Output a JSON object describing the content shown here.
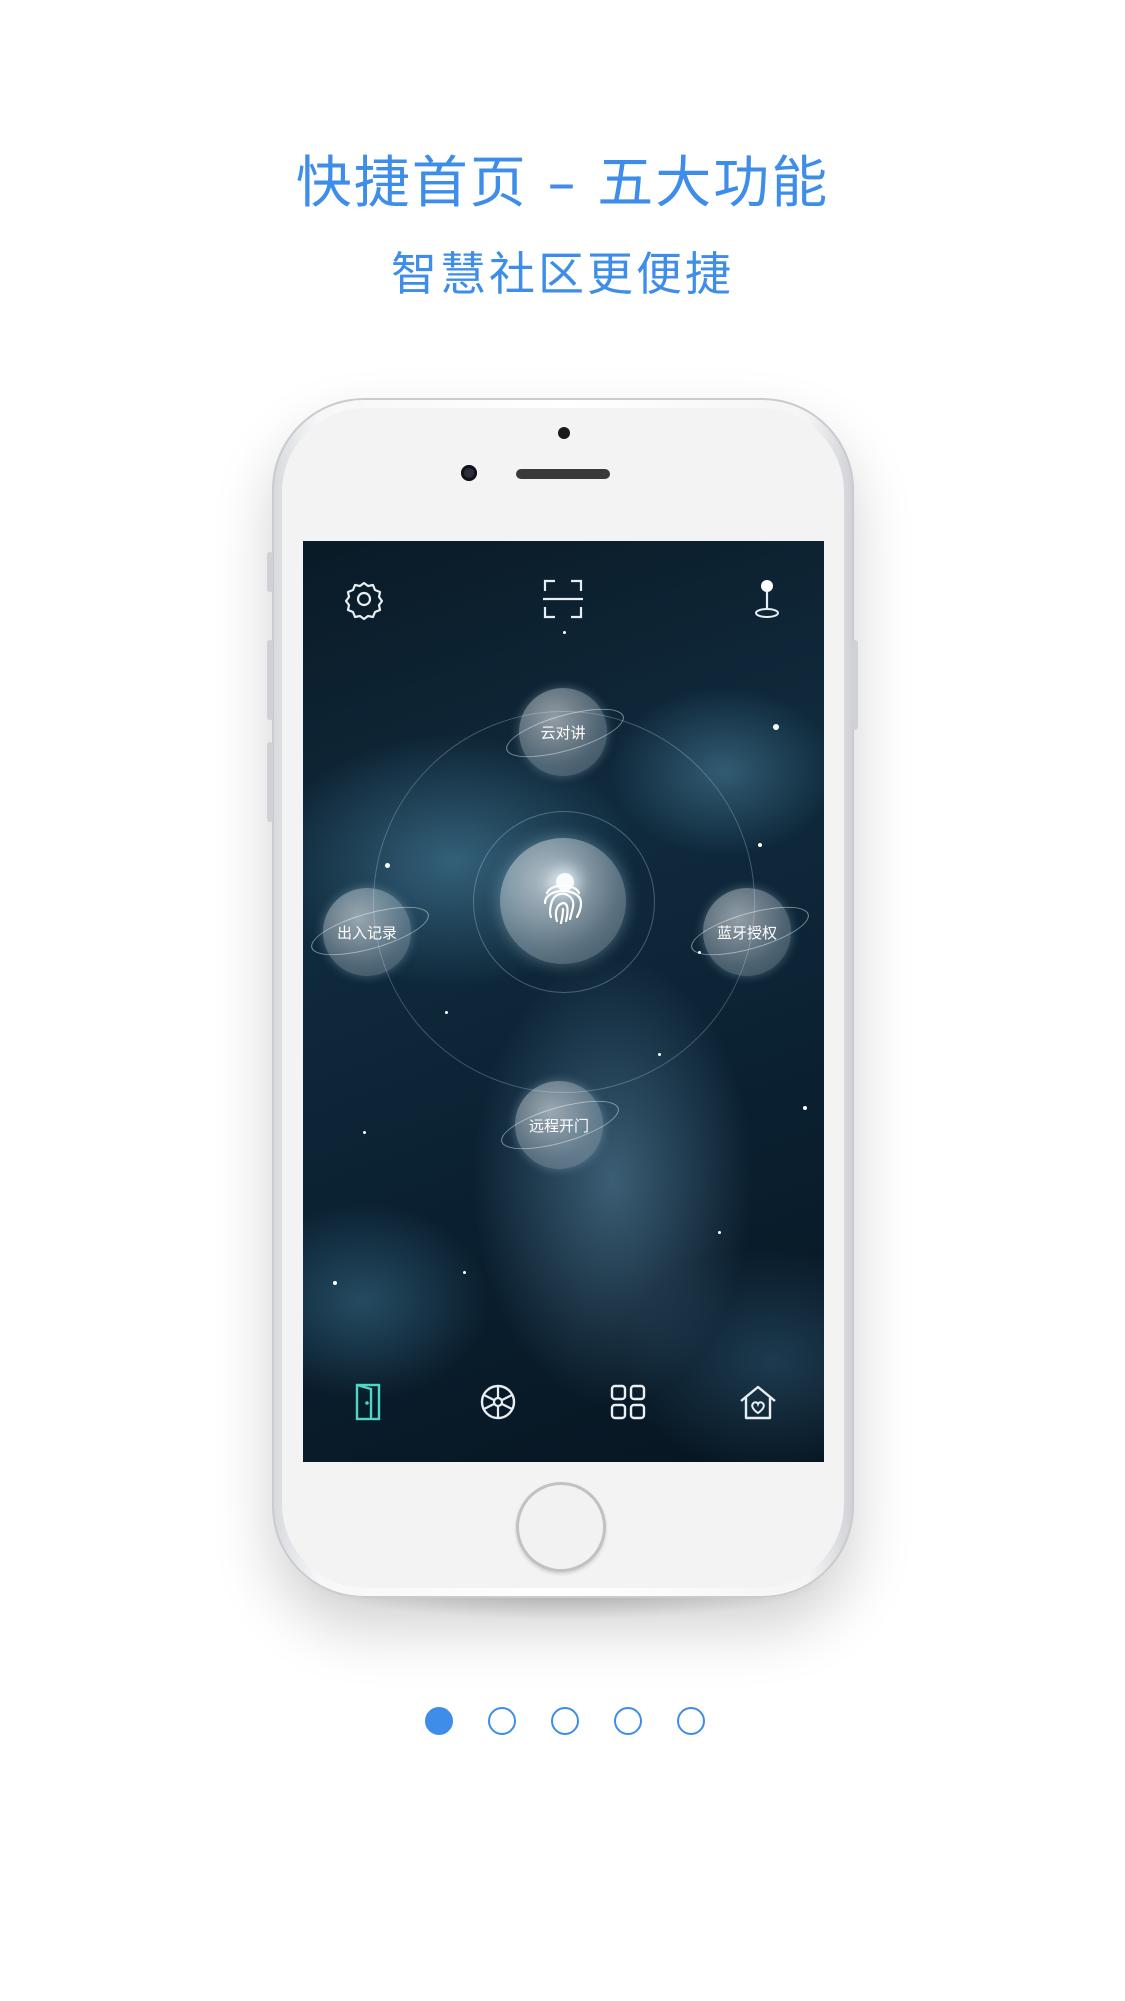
{
  "header": {
    "title": "快捷首页 – 五大功能",
    "subtitle": "智慧社区更便捷"
  },
  "screen": {
    "top_bar": {
      "left_icon": "gear-icon",
      "center_icon": "scan-icon",
      "right_icon": "location-pin-icon"
    },
    "features": {
      "top": "云对讲",
      "left": "出入记录",
      "right": "蓝牙授权",
      "bottom": "远程开门",
      "center_icon": "fingerprint-icon"
    },
    "tab_bar": {
      "items": [
        {
          "icon": "door-icon",
          "active": true
        },
        {
          "icon": "wheel-icon",
          "active": false
        },
        {
          "icon": "grid-icon",
          "active": false
        },
        {
          "icon": "home-heart-icon",
          "active": false
        }
      ]
    }
  },
  "pagination": {
    "total": 5,
    "current": 1
  },
  "colors": {
    "accent": "#3e8de8",
    "active_tab": "#4fd6c8",
    "icon": "#e8eef2"
  }
}
